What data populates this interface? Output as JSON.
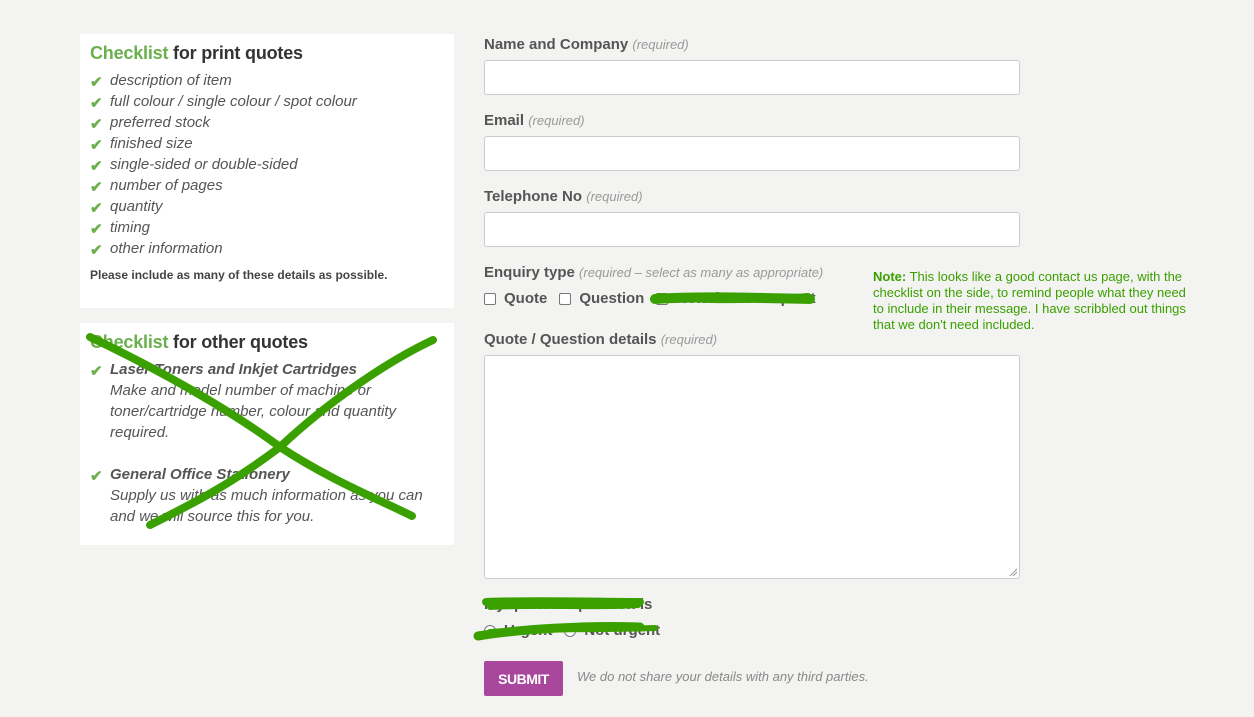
{
  "print_checklist": {
    "title_highlight": "Checklist",
    "title_rest": " for print quotes",
    "items": [
      "description of item",
      "full colour / single colour / spot colour",
      "preferred stock",
      "finished size",
      "single-sided or double-sided",
      "number of pages",
      "quantity",
      "timing",
      "other information"
    ],
    "note": "Please include as many of these details as possible."
  },
  "other_checklist": {
    "title_highlight": "Checklist",
    "title_rest": " for other quotes",
    "items": [
      {
        "heading": "Laser Toners and Inkjet Cartridges",
        "body": "Make and model number of machine or toner/cartridge number, colour and quantity required."
      },
      {
        "heading": "General Office Stationery",
        "body": "Supply us with as much information as you can and we will source this for you."
      }
    ]
  },
  "form": {
    "name": {
      "label": "Name and Company",
      "req": "(required)",
      "value": ""
    },
    "email": {
      "label": "Email",
      "req": "(required)",
      "value": ""
    },
    "phone": {
      "label": "Telephone No",
      "req": "(required)",
      "value": ""
    },
    "enquiry": {
      "label": "Enquiry type",
      "req": "(required – select as many as appropriate)",
      "options": [
        "Quote",
        "Question",
        "Newsletter Request"
      ]
    },
    "details": {
      "label": "Quote / Question details",
      "req": "(required)",
      "value": ""
    },
    "urgency": {
      "label": "My quote or question is",
      "options": [
        "Urgent",
        "Not urgent"
      ]
    },
    "submit_label": "SUBMIT",
    "privacy": "We do not share your details with any third parties."
  },
  "annotation": {
    "prefix": "Note:",
    "text": " This looks like a good contact us page, with the checklist on the side, to remind people what they need to include in their message. I have scribbled out things that we don't need included."
  },
  "colors": {
    "brand_green": "#6ab04c",
    "submit": "#a8479c",
    "scribble": "#3aa000"
  }
}
